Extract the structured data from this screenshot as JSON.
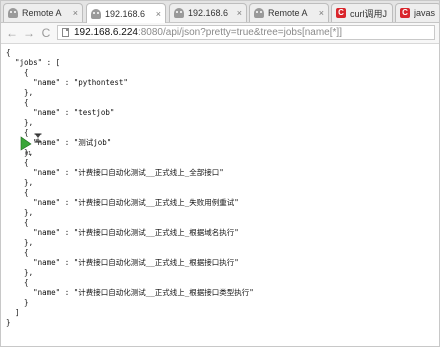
{
  "browser": {
    "tabs": [
      {
        "label": "Remote A",
        "icon": "ghost-icon",
        "active": false
      },
      {
        "label": "192.168.6",
        "icon": "ghost-icon",
        "active": true
      },
      {
        "label": "192.168.6",
        "icon": "ghost-icon",
        "active": false
      },
      {
        "label": "Remote A",
        "icon": "ghost-icon",
        "active": false
      },
      {
        "label": "curl调用J",
        "icon": "c-logo-icon",
        "active": false
      },
      {
        "label": "javas",
        "icon": "c-logo-icon",
        "active": false
      }
    ],
    "tab_close_glyph": "×",
    "c_logo_letter": "C",
    "nav": {
      "back": "←",
      "forward": "→",
      "reload": "C"
    },
    "url_host": "192.168.6.224",
    "url_rest": ":8080/api/json?pretty=true&tree=jobs[name[*]]"
  },
  "json_text": "{\n  \"jobs\" : [\n    {\n      \"name\" : \"pythontest\"\n    },\n    {\n      \"name\" : \"testjob\"\n    },\n    {\n      \"name\" : \"测试job\"\n    },\n    {\n      \"name\" : \"计费接口自动化测试__正式线上_全部接口\"\n    },\n    {\n      \"name\" : \"计费接口自动化测试__正式线上_失败用例重试\"\n    },\n    {\n      \"name\" : \"计费接口自动化测试__正式线上_根据域名执行\"\n    },\n    {\n      \"name\" : \"计费接口自动化测试__正式线上_根据接口执行\"\n    },\n    {\n      \"name\" : \"计费接口自动化测试__正式线上_根据接口类型执行\"\n    }\n  ]\n}",
  "cursor_badge": "01",
  "colors": {
    "cursor_arrow": "#3aa539",
    "c_logo": "#d9262c"
  }
}
